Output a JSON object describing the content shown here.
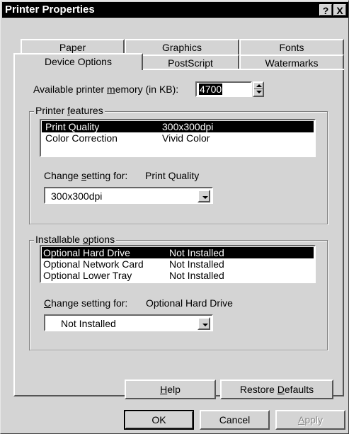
{
  "window": {
    "title": "Printer Properties",
    "help_button": "?",
    "close_button": "X"
  },
  "tabs": {
    "back_row": [
      "Paper",
      "Graphics",
      "Fonts"
    ],
    "front_row": [
      "Device Options",
      "PostScript",
      "Watermarks"
    ],
    "active": "Device Options"
  },
  "memory": {
    "label_pre": "Available printer ",
    "label_ul": "m",
    "label_post": "emory (in KB):",
    "value": "4700"
  },
  "printer_features": {
    "label_pre": "Printer ",
    "label_ul": "f",
    "label_post": "eatures",
    "items": [
      {
        "name": "Print Quality",
        "value": "300x300dpi",
        "selected": true
      },
      {
        "name": "Color Correction",
        "value": "Vivid Color",
        "selected": false
      }
    ],
    "change_label_pre": "Change ",
    "change_label_ul": "s",
    "change_label_post": "etting for:",
    "change_target": "Print Quality",
    "combo_value": "300x300dpi"
  },
  "installable_options": {
    "label_pre": "Installable ",
    "label_ul": "o",
    "label_post": "ptions",
    "items": [
      {
        "name": "Optional Hard Drive",
        "value": "Not Installed",
        "selected": true
      },
      {
        "name": "Optional Network Card",
        "value": "Not Installed",
        "selected": false
      },
      {
        "name": "Optional Lower Tray",
        "value": "Not Installed",
        "selected": false
      }
    ],
    "change_label_pre": "",
    "change_label_ul": "C",
    "change_label_post": "hange setting for:",
    "change_target": "Optional Hard Drive",
    "combo_value": "Not Installed"
  },
  "panel_buttons": {
    "help_ul": "H",
    "help_rest": "elp",
    "restore_pre": "Restore ",
    "restore_ul": "D",
    "restore_post": "efaults"
  },
  "footer_buttons": {
    "ok": "OK",
    "cancel": "Cancel",
    "apply_ul": "A",
    "apply_rest": "pply"
  }
}
